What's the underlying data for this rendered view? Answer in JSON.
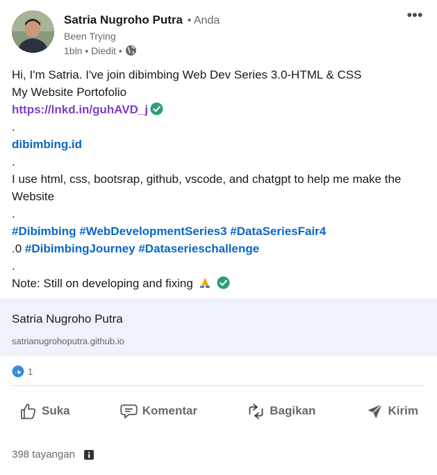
{
  "author": {
    "name": "Satria Nugroho Putra",
    "you_badge": "• Anda",
    "headline": "Been Trying",
    "meta": "1bln • Diedit •",
    "visibility_icon": "globe-icon"
  },
  "menu_icon": "more-horizontal-icon",
  "post": {
    "line1": "Hi, I'm Satria. I've join dibimbing Web Dev Series 3.0-HTML & CSS",
    "line2": "My Website Portofolio",
    "link1": "https://lnkd.in/guhAVD_j",
    "dot1": ".",
    "link2": "dibimbing.id",
    "dot2": ".",
    "line3": "I use html, css, bootsrap, github, vscode, and chatgpt to help me make the Website",
    "dot3": ".",
    "hashtags1": "#Dibimbing #WebDevelopmentSeries3 #DataSeriesFair4",
    "prefix2": ".0",
    "hashtags2": "#DibimbingJourney #Dataserieschallenge",
    "dot4": ".",
    "note": "Note: Still on developing and fixing"
  },
  "link_preview": {
    "title": "Satria Nugroho Putra",
    "url": "satrianugrohoputra.github.io"
  },
  "reactions": {
    "icon": "like-reaction-icon",
    "count": "1"
  },
  "actions": {
    "like": "Suka",
    "comment": "Komentar",
    "share": "Bagikan",
    "send": "Kirim"
  },
  "views": "398 tayangan",
  "colors": {
    "link_blue": "#0a66c2",
    "link_purple": "#7c3fc0",
    "preview_bg": "#edf3f8",
    "check_green": "#2e9d78"
  }
}
